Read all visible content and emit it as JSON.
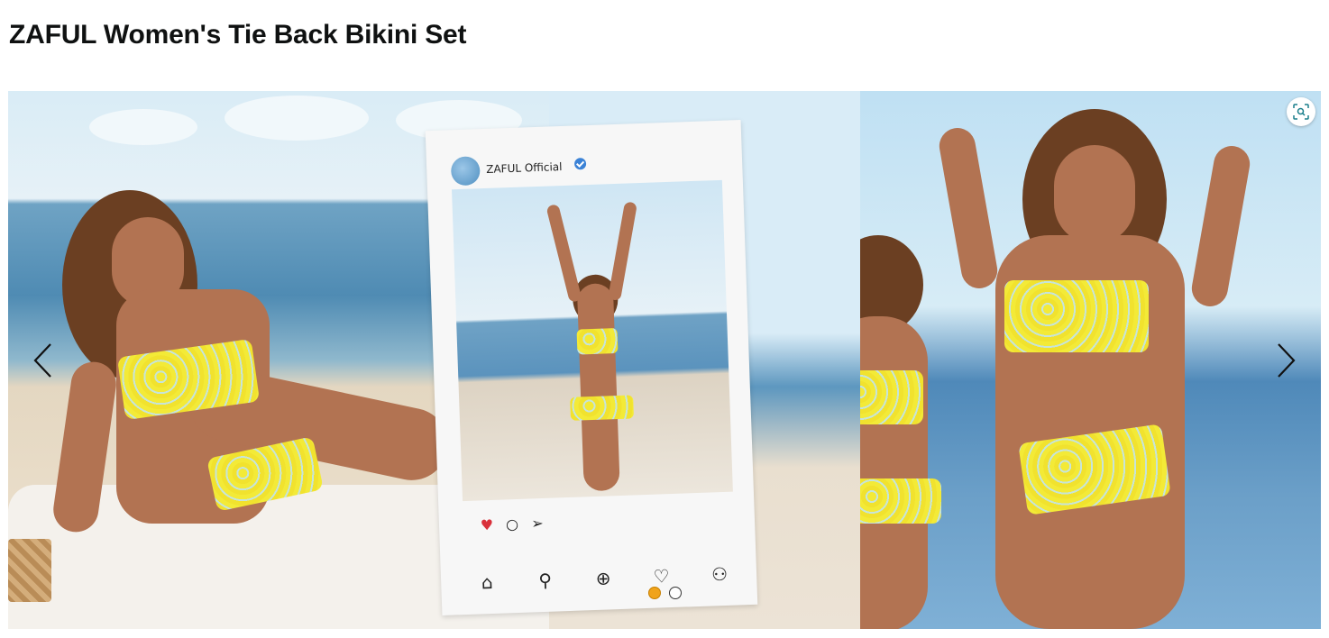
{
  "product": {
    "title": "ZAFUL Women's Tie Back Bikini Set"
  },
  "carousel": {
    "card_account_name": "ZAFUL Official",
    "slide_count": 2,
    "active_slide": 1,
    "active_dot_color": "#f0a31a"
  },
  "icons": {
    "prev": "chevron-left-icon",
    "next": "chevron-right-icon",
    "zoom": "zoom-icon",
    "like": "heart-icon",
    "comment": "comment-icon",
    "share": "send-icon",
    "home": "home-icon",
    "search": "search-icon",
    "add": "add-icon",
    "activity": "heart-icon",
    "profile": "profile-icon"
  }
}
